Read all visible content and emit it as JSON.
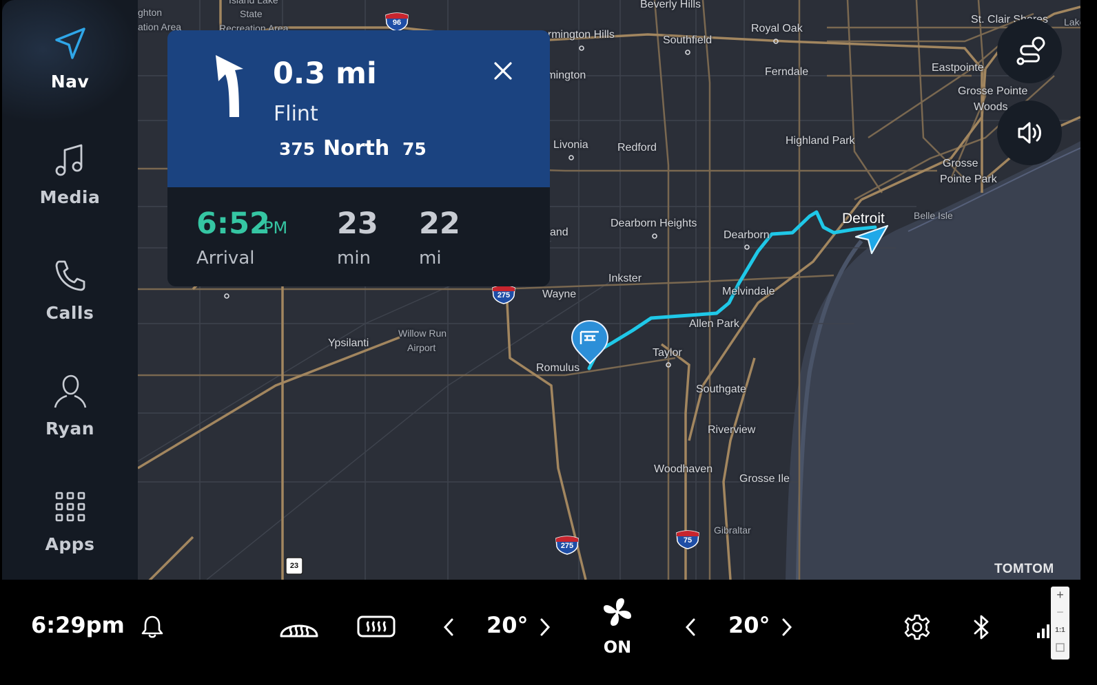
{
  "sidebar": {
    "items": [
      {
        "label": "Nav",
        "icon": "navigation-arrow-icon",
        "active": true
      },
      {
        "label": "Media",
        "icon": "music-note-icon"
      },
      {
        "label": "Calls",
        "icon": "phone-icon"
      },
      {
        "label": "Ryan",
        "icon": "user-icon"
      },
      {
        "label": "Apps",
        "icon": "grid-icon"
      }
    ]
  },
  "guidance": {
    "distance": "0.3 mi",
    "street": "Flint",
    "road_a": "375",
    "road_direction": "North",
    "road_b": "75",
    "turn_icon": "turn-left-arrow-icon"
  },
  "eta": {
    "arrival_time": "6:52",
    "arrival_ampm": "PM",
    "arrival_label": "Arrival",
    "duration_value": "23",
    "duration_unit": "min",
    "distance_value": "22",
    "distance_unit": "mi"
  },
  "map": {
    "brand": "TOMTOM",
    "labels": [
      "ghton",
      "ation Area",
      "Island Lake",
      "State",
      "Recreation Area",
      "Beverly Hills",
      "armington Hills",
      "Southfield",
      "Royal Oak",
      "St. Clair Shores",
      "Lake",
      "rmington",
      "Ferndale",
      "Eastpointe",
      "Grosse Pointe",
      "Woods",
      "Livonia",
      "Redford",
      "Highland Park",
      "Grosse",
      "Pointe Park",
      "Detroit",
      "Belle Isle",
      "Dearborn Heights",
      "Dearborn",
      "and",
      "Inkster",
      "Wayne",
      "Melvindale",
      "Allen Park",
      "Ypsilanti",
      "Willow Run",
      "Airport",
      "Romulus",
      "Taylor",
      "Southgate",
      "Riverview",
      "Woodhaven",
      "Grosse Ile",
      "Gibraltar"
    ],
    "shields": [
      "96",
      "275",
      "275",
      "75",
      "23"
    ],
    "route_color": "#1fc8e8",
    "water_color": "#3a4150"
  },
  "bottom": {
    "clock": "6:29pm",
    "left_temp": "20°",
    "right_temp": "20°",
    "fan_label": "ON"
  },
  "zoom": {
    "plus": "+",
    "minus": "−",
    "ratio": "1:1"
  }
}
